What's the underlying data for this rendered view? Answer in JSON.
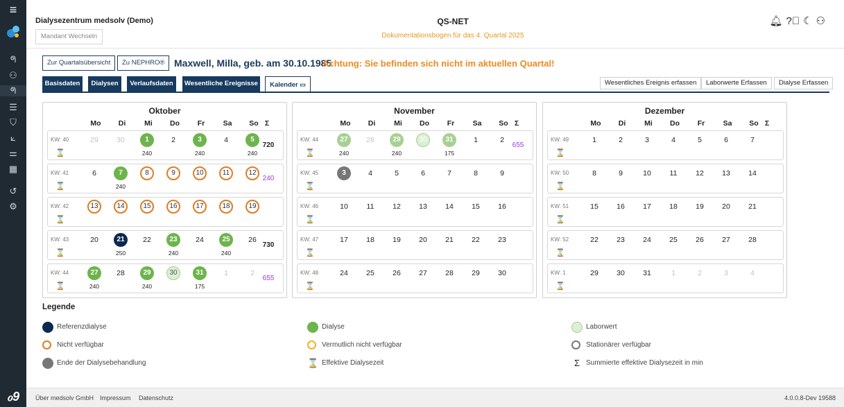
{
  "header": {
    "org_name": "Dialysezentrum medsolv (Demo)",
    "mandant_button": "Mandant Wechseln",
    "app_title": "QS-NET",
    "subtitle": "Dokumentationsbogen für das 4. Quartal 2025",
    "icons": [
      "bell-icon",
      "help-icon",
      "moon-icon",
      "user-icon"
    ]
  },
  "sidebar": {
    "icons": [
      "menu-icon",
      "logo-icon",
      "kidney-icon",
      "patients-icon",
      "kidney-icon",
      "list-icon",
      "shield-icon",
      "chart-icon",
      "settings-sliders-icon",
      "building-icon",
      "history-icon",
      "gear-icon",
      "brand-logo-icon"
    ]
  },
  "topbar": {
    "quartal_button": "Zur Quartalsübersicht",
    "nephro_button": "Zu NEPHRO®",
    "patient": "Maxwell, Milla, geb. am 30.10.1985",
    "warning": "Achtung: Sie befinden sich nicht im aktuellen Quartal!"
  },
  "tabs": [
    {
      "label": "Basisdaten"
    },
    {
      "label": "Dialysen"
    },
    {
      "label": "Verlaufsdaten"
    },
    {
      "label": "Wesentliche Ereignisse"
    },
    {
      "label": "Kalender"
    }
  ],
  "actions": [
    {
      "label": "Wesentliches Ereignis erfassen"
    },
    {
      "label": "Laborwerte Erfassen"
    },
    {
      "label": "Dialyse Erfassen"
    }
  ],
  "weekdays": [
    "Mo",
    "Di",
    "Mi",
    "Do",
    "Fr",
    "Sa",
    "So"
  ],
  "sum_symbol": "Σ",
  "hourglass_symbol": "⌛",
  "months": [
    {
      "name": "Oktober",
      "weeks": [
        {
          "kw": "KW: 40",
          "sum": "720",
          "sum_style": "bold",
          "days": [
            {
              "d": "29",
              "s": "faded"
            },
            {
              "d": "30",
              "s": "faded"
            },
            {
              "d": "1",
              "s": "green",
              "m": "240"
            },
            {
              "d": "2",
              "s": "plain"
            },
            {
              "d": "3",
              "s": "green",
              "m": "240"
            },
            {
              "d": "4",
              "s": "plain"
            },
            {
              "d": "5",
              "s": "green",
              "m": "240"
            }
          ]
        },
        {
          "kw": "KW: 41",
          "sum": "240",
          "sum_style": "purple",
          "days": [
            {
              "d": "6",
              "s": "plain"
            },
            {
              "d": "7",
              "s": "green",
              "m": "240"
            },
            {
              "d": "8",
              "s": "orange"
            },
            {
              "d": "9",
              "s": "orange"
            },
            {
              "d": "10",
              "s": "orange"
            },
            {
              "d": "11",
              "s": "orange"
            },
            {
              "d": "12",
              "s": "orange"
            }
          ]
        },
        {
          "kw": "KW: 42",
          "sum": "",
          "sum_style": "bold",
          "days": [
            {
              "d": "13",
              "s": "orange"
            },
            {
              "d": "14",
              "s": "orange"
            },
            {
              "d": "15",
              "s": "orange"
            },
            {
              "d": "16",
              "s": "orange"
            },
            {
              "d": "17",
              "s": "orange"
            },
            {
              "d": "18",
              "s": "orange"
            },
            {
              "d": "19",
              "s": "orange"
            }
          ]
        },
        {
          "kw": "KW: 43",
          "sum": "730",
          "sum_style": "bold",
          "days": [
            {
              "d": "20",
              "s": "plain"
            },
            {
              "d": "21",
              "s": "navy",
              "m": "250"
            },
            {
              "d": "22",
              "s": "plain"
            },
            {
              "d": "23",
              "s": "green",
              "m": "240"
            },
            {
              "d": "24",
              "s": "plain"
            },
            {
              "d": "25",
              "s": "green",
              "m": "240"
            },
            {
              "d": "26",
              "s": "plain"
            }
          ]
        },
        {
          "kw": "KW: 44",
          "sum": "655",
          "sum_style": "purple",
          "days": [
            {
              "d": "27",
              "s": "green",
              "m": "240"
            },
            {
              "d": "28",
              "s": "plain"
            },
            {
              "d": "29",
              "s": "green",
              "m": "240"
            },
            {
              "d": "30",
              "s": "lab"
            },
            {
              "d": "31",
              "s": "green",
              "m": "175"
            },
            {
              "d": "1",
              "s": "faded"
            },
            {
              "d": "2",
              "s": "faded"
            }
          ]
        }
      ]
    },
    {
      "name": "November",
      "weeks": [
        {
          "kw": "KW: 44",
          "sum": "655",
          "sum_style": "purple",
          "days": [
            {
              "d": "27",
              "s": "green-faded",
              "m": "240"
            },
            {
              "d": "28",
              "s": "faded"
            },
            {
              "d": "29",
              "s": "green-faded",
              "m": "240"
            },
            {
              "d": "30",
              "s": "lab-faded"
            },
            {
              "d": "31",
              "s": "green-faded",
              "m": "175"
            },
            {
              "d": "1",
              "s": "plain"
            },
            {
              "d": "2",
              "s": "plain"
            }
          ]
        },
        {
          "kw": "KW: 45",
          "sum": "",
          "sum_style": "bold",
          "days": [
            {
              "d": "3",
              "s": "gray"
            },
            {
              "d": "4",
              "s": "plain"
            },
            {
              "d": "5",
              "s": "plain"
            },
            {
              "d": "6",
              "s": "plain"
            },
            {
              "d": "7",
              "s": "plain"
            },
            {
              "d": "8",
              "s": "plain"
            },
            {
              "d": "9",
              "s": "plain"
            }
          ]
        },
        {
          "kw": "KW: 46",
          "sum": "",
          "sum_style": "bold",
          "days": [
            {
              "d": "10",
              "s": "plain"
            },
            {
              "d": "11",
              "s": "plain"
            },
            {
              "d": "12",
              "s": "plain"
            },
            {
              "d": "13",
              "s": "plain"
            },
            {
              "d": "14",
              "s": "plain"
            },
            {
              "d": "15",
              "s": "plain"
            },
            {
              "d": "16",
              "s": "plain"
            }
          ]
        },
        {
          "kw": "KW: 47",
          "sum": "",
          "sum_style": "bold",
          "days": [
            {
              "d": "17",
              "s": "plain"
            },
            {
              "d": "18",
              "s": "plain"
            },
            {
              "d": "19",
              "s": "plain"
            },
            {
              "d": "20",
              "s": "plain"
            },
            {
              "d": "21",
              "s": "plain"
            },
            {
              "d": "22",
              "s": "plain"
            },
            {
              "d": "23",
              "s": "plain"
            }
          ]
        },
        {
          "kw": "KW: 48",
          "sum": "",
          "sum_style": "bold",
          "days": [
            {
              "d": "24",
              "s": "plain"
            },
            {
              "d": "25",
              "s": "plain"
            },
            {
              "d": "26",
              "s": "plain"
            },
            {
              "d": "27",
              "s": "plain"
            },
            {
              "d": "28",
              "s": "plain"
            },
            {
              "d": "29",
              "s": "plain"
            },
            {
              "d": "30",
              "s": "plain"
            }
          ]
        }
      ]
    },
    {
      "name": "Dezember",
      "weeks": [
        {
          "kw": "KW: 49",
          "sum": "",
          "sum_style": "bold",
          "days": [
            {
              "d": "1",
              "s": "plain"
            },
            {
              "d": "2",
              "s": "plain"
            },
            {
              "d": "3",
              "s": "plain"
            },
            {
              "d": "4",
              "s": "plain"
            },
            {
              "d": "5",
              "s": "plain"
            },
            {
              "d": "6",
              "s": "plain"
            },
            {
              "d": "7",
              "s": "plain"
            }
          ]
        },
        {
          "kw": "KW: 50",
          "sum": "",
          "sum_style": "bold",
          "days": [
            {
              "d": "8",
              "s": "plain"
            },
            {
              "d": "9",
              "s": "plain"
            },
            {
              "d": "10",
              "s": "plain"
            },
            {
              "d": "11",
              "s": "plain"
            },
            {
              "d": "12",
              "s": "plain"
            },
            {
              "d": "13",
              "s": "plain"
            },
            {
              "d": "14",
              "s": "plain"
            }
          ]
        },
        {
          "kw": "KW: 51",
          "sum": "",
          "sum_style": "bold",
          "days": [
            {
              "d": "15",
              "s": "plain"
            },
            {
              "d": "16",
              "s": "plain"
            },
            {
              "d": "17",
              "s": "plain"
            },
            {
              "d": "18",
              "s": "plain"
            },
            {
              "d": "19",
              "s": "plain"
            },
            {
              "d": "20",
              "s": "plain"
            },
            {
              "d": "21",
              "s": "plain"
            }
          ]
        },
        {
          "kw": "KW: 52",
          "sum": "",
          "sum_style": "bold",
          "days": [
            {
              "d": "22",
              "s": "plain"
            },
            {
              "d": "23",
              "s": "plain"
            },
            {
              "d": "24",
              "s": "plain"
            },
            {
              "d": "25",
              "s": "plain"
            },
            {
              "d": "26",
              "s": "plain"
            },
            {
              "d": "27",
              "s": "plain"
            },
            {
              "d": "28",
              "s": "plain"
            }
          ]
        },
        {
          "kw": "KW: 1",
          "sum": "",
          "sum_style": "bold",
          "days": [
            {
              "d": "29",
              "s": "plain"
            },
            {
              "d": "30",
              "s": "plain"
            },
            {
              "d": "31",
              "s": "plain"
            },
            {
              "d": "1",
              "s": "faded"
            },
            {
              "d": "2",
              "s": "faded"
            },
            {
              "d": "3",
              "s": "faded"
            },
            {
              "d": "4",
              "s": "faded"
            }
          ]
        }
      ]
    }
  ],
  "legend": {
    "title": "Legende",
    "items": [
      {
        "label": "Referenzdialyse",
        "marker": "navy"
      },
      {
        "label": "Nicht verfügbar",
        "marker": "orange"
      },
      {
        "label": "Ende der Dialysebehandlung",
        "marker": "gray"
      },
      {
        "label": "Dialyse",
        "marker": "green"
      },
      {
        "label": "Vermutlich nicht verfügbar",
        "marker": "yellow"
      },
      {
        "label": "Effektive Dialysezeit",
        "marker": "hourglass"
      },
      {
        "label": "Laborwert",
        "marker": "lab"
      },
      {
        "label": "Stationärer verfügbar",
        "marker": "grayring"
      },
      {
        "label": "Summierte effektive Dialysezeit in min",
        "marker": "sigma"
      }
    ]
  },
  "colors": {
    "navy": "#0c2a4f",
    "green": "#6db44d",
    "orange": "#e07b22",
    "yellow": "#f0b422",
    "purple": "#9a3ed3",
    "warning": "#ee8a22",
    "sidebar": "#1f2a33"
  },
  "footer": {
    "links": [
      "Über medsolv GmbH",
      "Impressum",
      "Datenschutz"
    ],
    "version": "4.0.0.8-Dev 19588"
  }
}
